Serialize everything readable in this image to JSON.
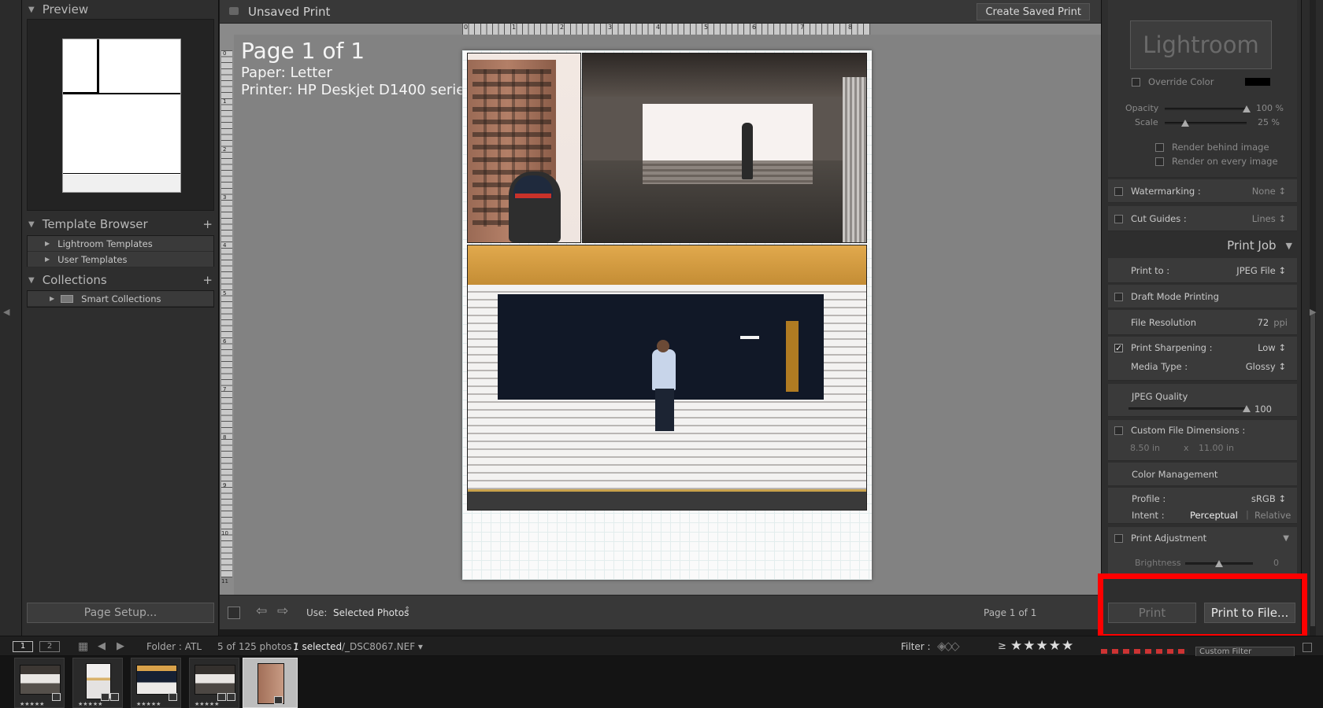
{
  "left_panel": {
    "preview_title": "Preview",
    "template_browser_title": "Template Browser",
    "template_items": [
      "Lightroom Templates",
      "User Templates"
    ],
    "collections_title": "Collections",
    "collection_items": [
      "Smart Collections"
    ],
    "page_setup_label": "Page Setup..."
  },
  "top_bar": {
    "title": "Unsaved Print",
    "create_saved_label": "Create Saved Print"
  },
  "ruler": {
    "h_ticks": [
      "0",
      "1",
      "2",
      "3",
      "4",
      "5",
      "6",
      "7",
      "8"
    ],
    "v_ticks": [
      "0",
      "1",
      "2",
      "3",
      "4",
      "5",
      "6",
      "7",
      "8",
      "9",
      "10",
      "11"
    ]
  },
  "page_info": {
    "page": "Page 1 of 1",
    "paper": "Paper:  Letter",
    "printer": "Printer:  HP Deskjet D1400 series"
  },
  "bottom_toolbar": {
    "use_label": "Use:",
    "use_value": "Selected Photos",
    "page_count": "Page 1 of 1"
  },
  "right_panel": {
    "identity_plate_text": "Lightroom",
    "override_color_label": "Override Color",
    "opacity_label": "Opacity",
    "opacity_value": "100 %",
    "opacity_level": 1.0,
    "scale_label": "Scale",
    "scale_value": "25 %",
    "scale_level": 0.25,
    "render_behind_label": "Render behind image",
    "render_every_label": "Render on every image",
    "watermarking_label": "Watermarking :",
    "watermarking_value": "None ↕",
    "cut_guides_label": "Cut Guides :",
    "cut_guides_value": "Lines ↕",
    "print_job_title": "Print Job",
    "print_to_label": "Print to :",
    "print_to_value": "JPEG File ↕",
    "draft_mode_label": "Draft Mode Printing",
    "file_resolution_label": "File Resolution",
    "file_resolution_value": "72",
    "file_resolution_unit": "ppi",
    "print_sharpening_label": "Print Sharpening :",
    "print_sharpening_value": "Low ↕",
    "media_type_label": "Media Type :",
    "media_type_value": "Glossy ↕",
    "jpeg_quality_label": "JPEG Quality",
    "jpeg_quality_value": "100",
    "jpeg_quality_level": 1.0,
    "custom_dims_label": "Custom File Dimensions :",
    "custom_width": "8.50 in",
    "custom_x": "x",
    "custom_height": "11.00 in",
    "color_mgmt_label": "Color Management",
    "profile_label": "Profile :",
    "profile_value": "sRGB ↕",
    "intent_label": "Intent :",
    "intent_perceptual": "Perceptual",
    "intent_sep": "|",
    "intent_relative": "Relative",
    "print_adjustment_label": "Print Adjustment",
    "brightness_label": "Brightness",
    "brightness_value": "0",
    "brightness_level": 0.5,
    "print_label": "Print",
    "print_to_file_label": "Print to File..."
  },
  "film_bar": {
    "screen1": "1",
    "screen2": "2",
    "folder": "Folder : ATL",
    "count": "5 of 125 photos /",
    "selected": "1 selected",
    "filename": "/_DSC8067.NEF ▾",
    "filter_label": "Filter :",
    "rating_op": "≥",
    "stars": "★★★★★",
    "custom_filter": "Custom Filter"
  },
  "filmstrip": {
    "thumb_stars": "★★★★★"
  },
  "colors": {
    "highlight_red": "#ff0000",
    "panel_bg": "#2e2e2e",
    "workspace_bg": "#828282"
  }
}
